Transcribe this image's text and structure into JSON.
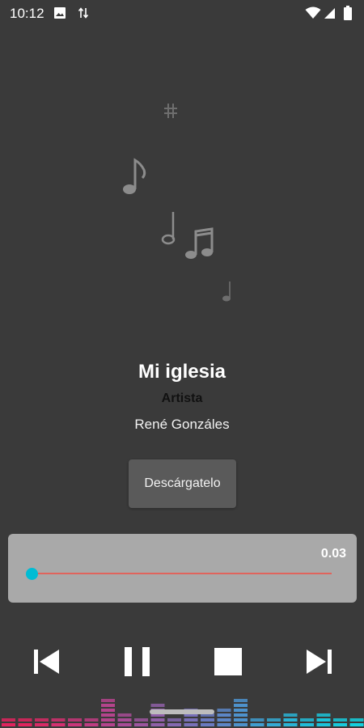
{
  "status_bar": {
    "time": "10:12",
    "left_icons": [
      "image-icon",
      "data-transfer-icon"
    ],
    "right_icons": [
      "wifi-icon",
      "signal-icon",
      "battery-icon"
    ]
  },
  "song": {
    "title": "Mi iglesia",
    "artist_label": "Artista",
    "artist": "René Gonzáles"
  },
  "download_button": {
    "label": "Descárgatelo"
  },
  "player": {
    "elapsed": "0.03",
    "progress": 0.0,
    "accent_color": "#00bcd4",
    "track_color": "#e0645c"
  },
  "controls": [
    "previous-icon",
    "pause-icon",
    "stop-icon",
    "next-icon"
  ],
  "colors": {
    "background": "#3a3a3a",
    "card": "#a9a9a9",
    "button": "#5a5a5a"
  }
}
